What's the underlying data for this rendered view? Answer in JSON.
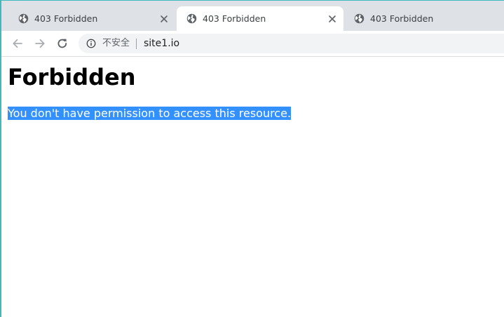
{
  "browser": {
    "tabs": [
      {
        "title": "403 Forbidden",
        "active": false
      },
      {
        "title": "403 Forbidden",
        "active": true
      },
      {
        "title": "403 Forbidden",
        "active": false
      }
    ],
    "security_label": "不安全",
    "url": "site1.io"
  },
  "page": {
    "heading": "Forbidden",
    "message": "You don't have permission to access this resource."
  },
  "colors": {
    "selection_bg": "#3390ff",
    "tabstrip_bg": "#dee1e6",
    "window_border": "#3fb8c0"
  }
}
